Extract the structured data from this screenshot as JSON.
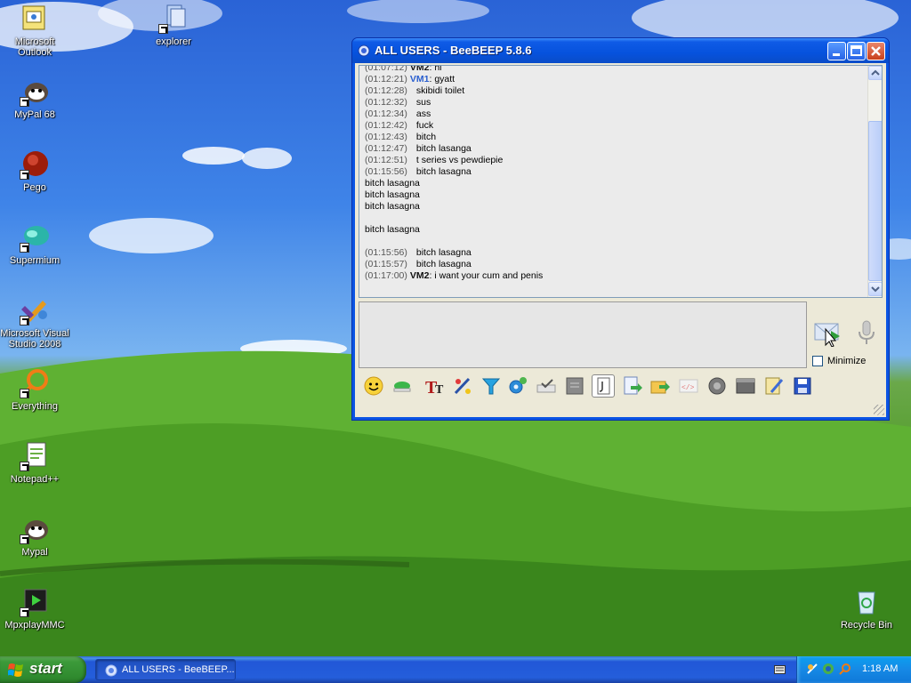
{
  "desktop": {
    "icons": [
      {
        "label": "Microsoft Outlook",
        "icon": "outlook-icon"
      },
      {
        "label": "explorer",
        "icon": "explorer-icon"
      },
      {
        "label": "MyPal 68",
        "icon": "mypal-icon"
      },
      {
        "label": "Pego",
        "icon": "pego-icon"
      },
      {
        "label": "Supermium",
        "icon": "supermium-icon"
      },
      {
        "label": "Microsoft Visual Studio 2008",
        "icon": "visual-studio-icon"
      },
      {
        "label": "Everything",
        "icon": "everything-icon"
      },
      {
        "label": "Notepad++",
        "icon": "notepad-plus-plus-icon"
      },
      {
        "label": "Mypal",
        "icon": "mypal-icon"
      },
      {
        "label": "MpxplayMMC",
        "icon": "mpxplay-icon"
      },
      {
        "label": "Recycle Bin",
        "icon": "recycle-bin-icon"
      }
    ]
  },
  "window": {
    "title": "ALL USERS - BeeBEEP 5.8.6",
    "colors": {
      "vm1": "#2a5fcf",
      "vm2": "#111111",
      "titlebar": "#0652dd"
    },
    "chat": [
      {
        "ts": "(01:07:12)",
        "sender": "VM2",
        "sep": ": ",
        "text": "hi"
      },
      {
        "ts": "(01:12:21)",
        "sender": "VM1",
        "sep": ": ",
        "text": "gyatt"
      },
      {
        "ts": "(01:12:28)",
        "sender": "",
        "sep": "",
        "text": "skibidi toilet"
      },
      {
        "ts": "(01:12:32)",
        "sender": "",
        "sep": "",
        "text": "sus"
      },
      {
        "ts": "(01:12:34)",
        "sender": "",
        "sep": "",
        "text": "ass"
      },
      {
        "ts": "(01:12:42)",
        "sender": "",
        "sep": "",
        "text": "fuck"
      },
      {
        "ts": "(01:12:43)",
        "sender": "",
        "sep": "",
        "text": "bitch"
      },
      {
        "ts": "(01:12:47)",
        "sender": "",
        "sep": "",
        "text": "bitch lasanga"
      },
      {
        "ts": "(01:12:51)",
        "sender": "",
        "sep": "",
        "text": "t series vs pewdiepie"
      },
      {
        "ts": "(01:15:56)",
        "sender": "",
        "sep": "",
        "text": "bitch lasagna"
      },
      {
        "ts": "",
        "sender": "",
        "sep": "",
        "text": "bitch lasagna"
      },
      {
        "ts": "",
        "sender": "",
        "sep": "",
        "text": "bitch lasagna"
      },
      {
        "ts": "",
        "sender": "",
        "sep": "",
        "text": "bitch lasagna"
      },
      {
        "ts": "",
        "sender": "",
        "sep": "",
        "text": ""
      },
      {
        "ts": "",
        "sender": "",
        "sep": "",
        "text": "bitch lasagna"
      },
      {
        "ts": "",
        "sender": "",
        "sep": "",
        "text": ""
      },
      {
        "ts": "(01:15:56)",
        "sender": "",
        "sep": "",
        "text": "bitch lasagna"
      },
      {
        "ts": "(01:15:57)",
        "sender": "",
        "sep": "",
        "text": "bitch lasagna"
      },
      {
        "ts": "(01:17:00)",
        "sender": "VM2",
        "sep": ": ",
        "text": "i want your cum and penis"
      }
    ],
    "input_value": "",
    "minimize_label": "Minimize",
    "minimize_checked": false,
    "toolbar_icons": [
      "emoticon-icon",
      "color-icon",
      "text-format-icon",
      "draw-icon",
      "filter-icon",
      "settings-icon",
      "spell-check-icon",
      "notes-icon",
      "clipboard-icon",
      "file-send-icon",
      "folder-send-icon",
      "html-icon",
      "screenshot-icon",
      "history-icon",
      "edit-icon",
      "save-icon"
    ]
  },
  "taskbar": {
    "start_label": "start",
    "task_label": "ALL USERS - BeeBEEP...",
    "clock": "1:18 AM"
  }
}
